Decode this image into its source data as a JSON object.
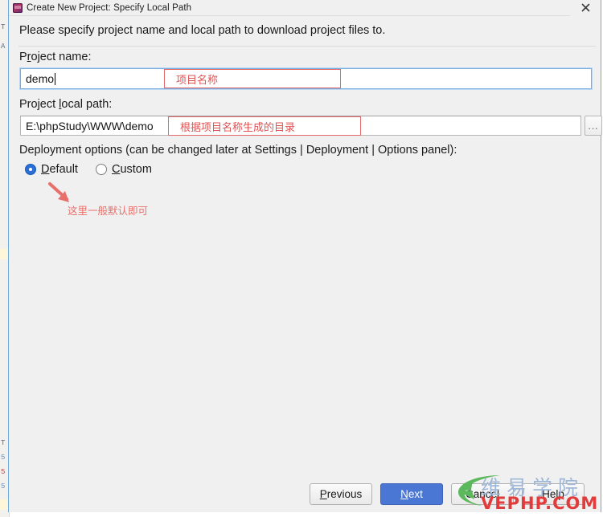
{
  "window": {
    "title": "Create New Project: Specify Local Path",
    "icon": "phpstorm-icon",
    "close_label": "✕"
  },
  "header": {
    "instruction": "Please specify project name and local path to download project files to."
  },
  "form": {
    "project_name": {
      "label_pre": "P",
      "label_mnemonic": "r",
      "label_post": "oject name:",
      "value": "demo",
      "placeholder": ""
    },
    "project_local_path": {
      "label_pre": "Project ",
      "label_mnemonic": "l",
      "label_post": "ocal path:",
      "value": "E:\\phpStudy\\WWW\\demo",
      "placeholder": "",
      "browse_label": "..."
    },
    "deployment": {
      "label": "Deployment options (can be changed later at Settings | Deployment | Options panel):",
      "options": [
        {
          "label_mnemonic": "D",
          "label_rest": "efault",
          "selected": true
        },
        {
          "label_mnemonic": "C",
          "label_rest": "ustom",
          "selected": false
        }
      ]
    }
  },
  "annotations": {
    "project_name_note": "项目名称",
    "project_path_note": "根据项目名称生成的目录",
    "deployment_note": "这里一般默认即可",
    "color": "#e05252"
  },
  "footer": {
    "buttons": [
      {
        "name": "previous",
        "mnemonic": "P",
        "rest": "revious",
        "style": "std"
      },
      {
        "name": "next",
        "mnemonic": "N",
        "rest": "ext",
        "style": "primary"
      },
      {
        "name": "cancel",
        "mnemonic": "",
        "rest": "Cancel",
        "style": "std"
      },
      {
        "name": "help",
        "mnemonic": "",
        "rest": "Help",
        "style": "std"
      }
    ]
  },
  "watermark": {
    "cn": "维易学院",
    "en": "VEPHP.COM",
    "cn_color": "#9fb8d8",
    "en_color": "#e23b3b",
    "swoosh_color": "#5cb85c"
  },
  "background_editor": {
    "gutter_glyphs": [
      "T",
      "A",
      "T",
      "5",
      "5",
      "5"
    ]
  }
}
